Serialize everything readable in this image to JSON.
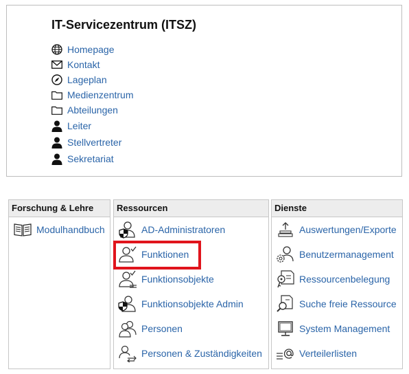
{
  "unit": {
    "title": "IT-Servicezentrum (ITSZ)",
    "links": [
      {
        "label": "Homepage",
        "icon": "globe-icon"
      },
      {
        "label": "Kontakt",
        "icon": "envelope-icon"
      },
      {
        "label": "Lageplan",
        "icon": "compass-icon"
      },
      {
        "label": "Medienzentrum",
        "icon": "folder-icon"
      },
      {
        "label": "Abteilungen",
        "icon": "folder-icon"
      },
      {
        "label": "Leiter",
        "icon": "person-icon"
      },
      {
        "label": "Stellvertreter",
        "icon": "person-icon"
      },
      {
        "label": "Sekretariat",
        "icon": "person-icon"
      }
    ]
  },
  "panels": {
    "forschung": {
      "title": "Forschung & Lehre",
      "items": [
        {
          "label": "Modulhandbuch",
          "icon": "book-icon"
        }
      ]
    },
    "ressourcen": {
      "title": "Ressourcen",
      "items": [
        {
          "label": "AD-Administratoren",
          "icon": "user-shield-icon"
        },
        {
          "label": "Funktionen",
          "icon": "user-check-icon"
        },
        {
          "label": "Funktionsobjekte",
          "icon": "user-check-group-icon"
        },
        {
          "label": "Funktionsobjekte Admin",
          "icon": "user-shield-group-icon"
        },
        {
          "label": "Personen",
          "icon": "users-icon"
        },
        {
          "label": "Personen & Zuständigkeiten",
          "icon": "user-transfer-icon"
        }
      ]
    },
    "dienste": {
      "title": "Dienste",
      "items": [
        {
          "label": "Auswertungen/Exporte",
          "icon": "export-icon"
        },
        {
          "label": "Benutzermanagement",
          "icon": "user-gear-icon"
        },
        {
          "label": "Ressourcenbelegung",
          "icon": "key-document-icon"
        },
        {
          "label": "Suche freie Ressource",
          "icon": "search-document-icon"
        },
        {
          "label": "System Management",
          "icon": "monitor-icon"
        },
        {
          "label": "Verteilerlisten",
          "icon": "mailing-list-icon"
        }
      ]
    }
  },
  "highlight_color": "#e0141c",
  "link_color": "#2a64a8"
}
